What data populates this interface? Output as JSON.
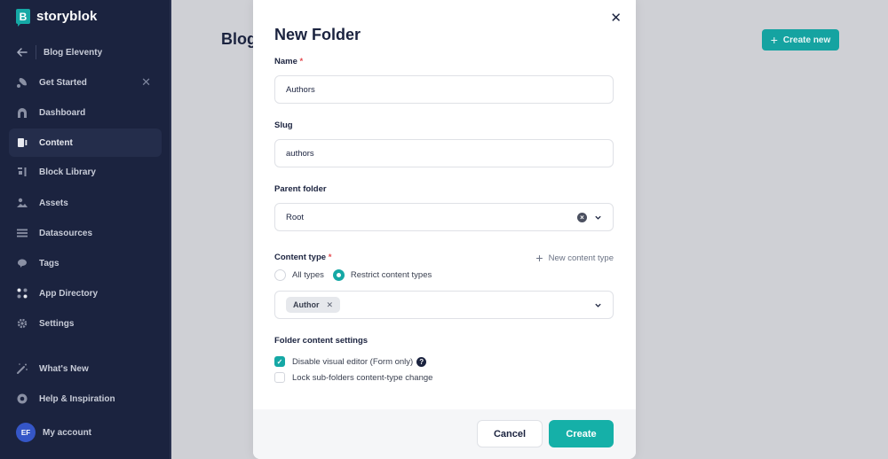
{
  "app": {
    "logo_text": "storyblok",
    "logo_letter": "B"
  },
  "sidebar": {
    "back_label": "Blog Eleventy",
    "items": [
      {
        "label": "Get Started",
        "icon": "rocket-icon",
        "closable": true
      },
      {
        "label": "Dashboard",
        "icon": "dashboard-icon"
      },
      {
        "label": "Content",
        "icon": "content-icon",
        "active": true
      },
      {
        "label": "Block Library",
        "icon": "block-library-icon"
      },
      {
        "label": "Assets",
        "icon": "assets-icon"
      },
      {
        "label": "Datasources",
        "icon": "datasources-icon"
      },
      {
        "label": "Tags",
        "icon": "tags-icon"
      },
      {
        "label": "App Directory",
        "icon": "app-directory-icon"
      },
      {
        "label": "Settings",
        "icon": "settings-icon"
      }
    ],
    "bottom_items": [
      {
        "label": "What's New",
        "icon": "magic-wand-icon"
      },
      {
        "label": "Help & Inspiration",
        "icon": "lifebuoy-icon"
      }
    ],
    "account": {
      "initials": "EF",
      "label": "My account"
    }
  },
  "main": {
    "title": "Blog",
    "create_new_label": "Create new"
  },
  "modal": {
    "title": "New Folder",
    "name": {
      "label": "Name",
      "required": "*",
      "value": "Authors"
    },
    "slug": {
      "label": "Slug",
      "value": "authors"
    },
    "parent_folder": {
      "label": "Parent folder",
      "value": "Root"
    },
    "content_type": {
      "label": "Content type",
      "required": "*",
      "new_content_type_label": "New content type",
      "options": [
        {
          "label": "All types",
          "checked": false
        },
        {
          "label": "Restrict content types",
          "checked": true
        }
      ],
      "selected_tags": [
        "Author"
      ]
    },
    "folder_settings": {
      "label": "Folder content settings",
      "checkboxes": [
        {
          "label": "Disable visual editor (Form only)",
          "checked": true,
          "has_help": true
        },
        {
          "label": "Lock sub-folders content-type change",
          "checked": false
        }
      ]
    },
    "footer": {
      "cancel_label": "Cancel",
      "create_label": "Create"
    }
  }
}
